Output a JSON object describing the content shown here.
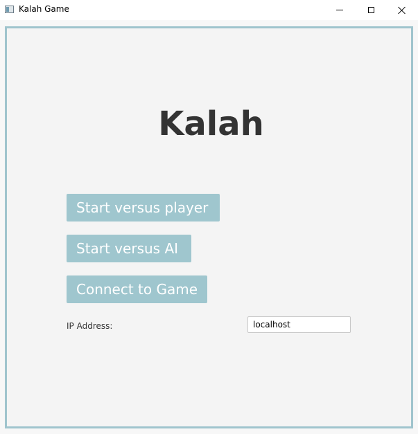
{
  "window": {
    "title": "Kalah Game",
    "icon": "app-window-icon",
    "controls": [
      "minimize-icon",
      "maximize-icon",
      "close-icon"
    ]
  },
  "main": {
    "title": "Kalah",
    "buttons": {
      "start_vs_player": "Start versus player",
      "start_vs_ai": "Start versus AI",
      "connect": "Connect to Game"
    },
    "ip": {
      "label": "IP Address:",
      "value": "localhost"
    }
  },
  "colors": {
    "accent": "#9fc6ce",
    "panel_border": "#9fc4cd",
    "title_text": "#333333",
    "button_text": "#ffffff"
  }
}
